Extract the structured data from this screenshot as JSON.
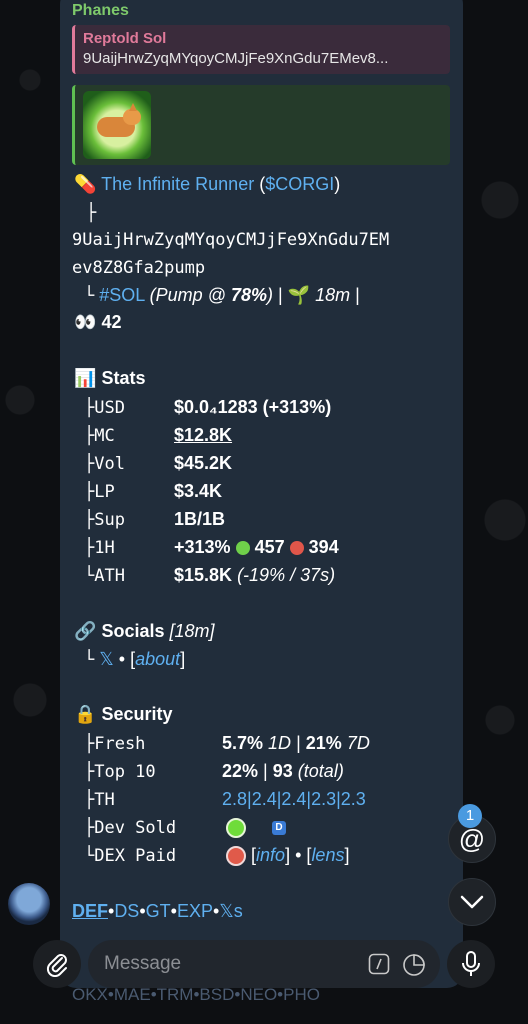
{
  "message": {
    "sender": "Phanes",
    "reply": {
      "author": "Reptold Sol",
      "text": "9UaijHrwZyqMYqoyCMJjFe9XnGdu7EMev8..."
    },
    "token": {
      "name": "The Infinite Runner",
      "ticker": "$CORGI",
      "branch1": "├",
      "address_line1": "9UaijHrwZyqMYqoyCMJjFe9XnGdu7EM",
      "address_line2": "ev8Z8Gfa2pump",
      "branch2": "└",
      "chain": "#SOL",
      "pump_prefix": "(Pump @ ",
      "pump_pct": "78%",
      "pump_suffix": ")",
      "sep1": "|",
      "age": "18m",
      "sep2": "|",
      "holders": "42"
    }
  },
  "stats": {
    "title": "Stats",
    "rows": [
      {
        "label": "├USD",
        "value": "$0.0₄1283 (+313%)"
      },
      {
        "label": "├MC",
        "value": "$12.8K"
      },
      {
        "label": "├Vol",
        "value": "$45.2K"
      },
      {
        "label": "├LP",
        "value": "$3.4K"
      },
      {
        "label": "├Sup",
        "value": "1B/1B"
      },
      {
        "label": "├1H",
        "value": "+313%",
        "buys": "457",
        "sells": "394"
      },
      {
        "label": "└ATH",
        "value": "$15.8K",
        "note": "(-19% / 37s)"
      }
    ]
  },
  "socials": {
    "title": "Socials",
    "age": "[18m]",
    "branch": "└",
    "x_label": "𝕏",
    "sep": "•",
    "about_label": "about"
  },
  "security": {
    "title": "Security",
    "rows": [
      {
        "label": "├Fresh",
        "v1": "5.7%",
        "p1": "1D",
        "sep": "|",
        "v2": "21%",
        "p2": "7D"
      },
      {
        "label": "├Top 10",
        "v1": "22%",
        "sep": "|",
        "v2": "93",
        "note": "(total)"
      },
      {
        "label": "├TH",
        "value": "2.8|2.4|2.4|2.3|2.3"
      },
      {
        "label": "├Dev Sold",
        "badge": "D"
      },
      {
        "label": "└DEX Paid",
        "info": "info",
        "sep": "•",
        "lens": "lens"
      }
    ]
  },
  "footer": {
    "links": [
      "DEF",
      "DS",
      "GT",
      "EXP",
      "𝕏s"
    ],
    "sep": "•",
    "row2": "OKX•MAE•TRM•BSD•NEO•PHO"
  },
  "ui": {
    "mention_symbol": "@",
    "mention_count": "1",
    "input_placeholder": "Message"
  }
}
